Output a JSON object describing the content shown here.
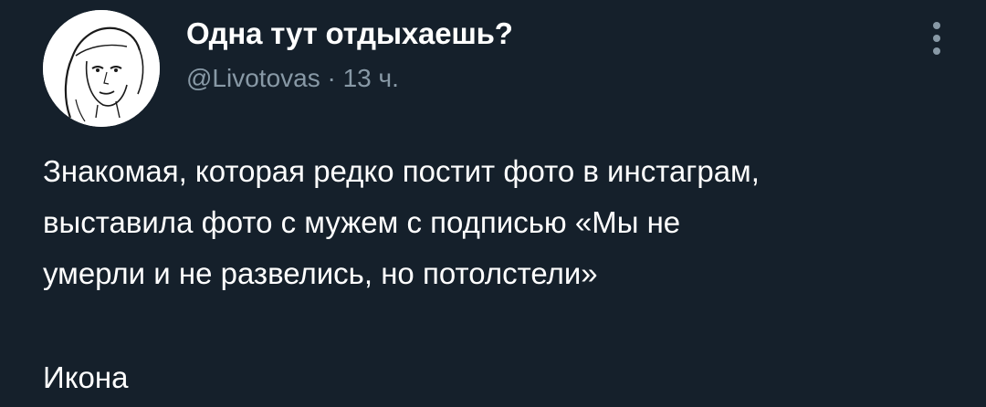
{
  "tweet": {
    "display_name": "Одна тут отдыхаешь?",
    "handle": "@Livotovas",
    "separator": "·",
    "time": "13 ч.",
    "text_lines": [
      "Знакомая, которая редко постит фото в инстаграм,",
      "выставила фото с мужем с подписью «Мы не",
      "умерли и не развелись, но потолстели»",
      "Икона"
    ],
    "more_icon": "vertical-ellipsis-icon",
    "avatar_icon": "user-avatar-sketch"
  },
  "colors": {
    "background": "#15202b",
    "primary_text": "#ffffff",
    "secondary_text": "#8899a6"
  }
}
